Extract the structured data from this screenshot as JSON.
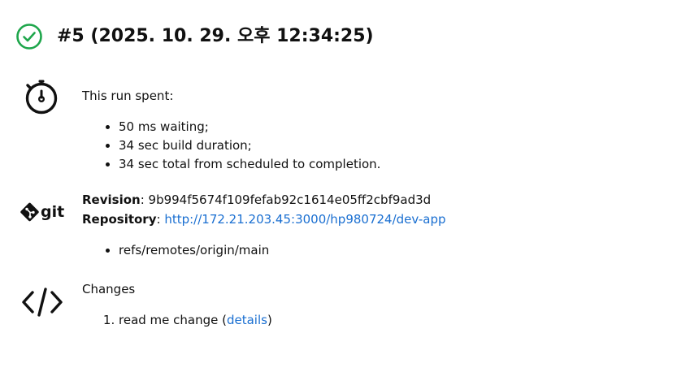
{
  "build": {
    "title": "#5 (2025. 10. 29. 오후 12:34:25)",
    "status_icon": "check-circle-icon",
    "status_color": "#1ea64b"
  },
  "timing": {
    "icon": "stopwatch-icon",
    "heading": "This run spent:",
    "items": [
      "50 ms waiting;",
      "34 sec build duration;",
      "34 sec total from scheduled to completion."
    ]
  },
  "scm": {
    "icon": "git-logo-icon",
    "revision_label": "Revision",
    "revision_value": "9b994f5674f109fefab92c1614e05ff2cbf9ad3d",
    "repository_label": "Repository",
    "repository_url": "http://172.21.203.45:3000/hp980724/dev-app",
    "branches": [
      "refs/remotes/origin/main"
    ]
  },
  "changes": {
    "icon": "code-brackets-icon",
    "heading": "Changes",
    "items": [
      {
        "message": "read me change",
        "link_label": "details"
      }
    ]
  },
  "colors": {
    "link": "#1a6fd1",
    "text": "#111111"
  }
}
